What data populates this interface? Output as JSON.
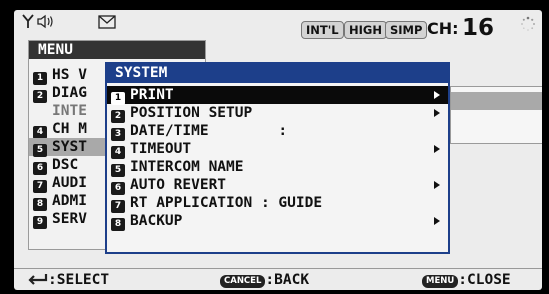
{
  "status": {
    "icons": [
      "antenna-icon",
      "speaker-icon",
      "mail-icon",
      "spinner-icon"
    ],
    "badges": [
      "INT'L",
      "HIGH",
      "SIMP"
    ],
    "ch_label": "CH:",
    "ch_number": "16"
  },
  "menu": {
    "title": "MENU",
    "items": [
      {
        "num": "1",
        "label": "HS V"
      },
      {
        "num": "2",
        "label": "DIAG"
      },
      {
        "num": "",
        "label": "INTE"
      },
      {
        "num": "4",
        "label": "CH M"
      },
      {
        "num": "5",
        "label": "SYST"
      },
      {
        "num": "6",
        "label": "DSC"
      },
      {
        "num": "7",
        "label": "AUDI"
      },
      {
        "num": "8",
        "label": "ADMI"
      },
      {
        "num": "9",
        "label": "SERV"
      }
    ]
  },
  "system": {
    "title": "SYSTEM",
    "items": [
      {
        "num": "1",
        "label": "PRINT"
      },
      {
        "num": "2",
        "label": "POSITION SETUP"
      },
      {
        "num": "3",
        "label": "DATE/TIME        :"
      },
      {
        "num": "4",
        "label": "TIMEOUT"
      },
      {
        "num": "5",
        "label": "INTERCOM NAME"
      },
      {
        "num": "6",
        "label": "AUTO REVERT"
      },
      {
        "num": "7",
        "label": "RT APPLICATION : GUIDE"
      },
      {
        "num": "8",
        "label": "BACKUP"
      }
    ]
  },
  "bottom": {
    "select_text": ":SELECT",
    "cancel_key": "CANCEL",
    "back_text": ":BACK",
    "menu_key": "MENU",
    "close_text": ":CLOSE"
  }
}
